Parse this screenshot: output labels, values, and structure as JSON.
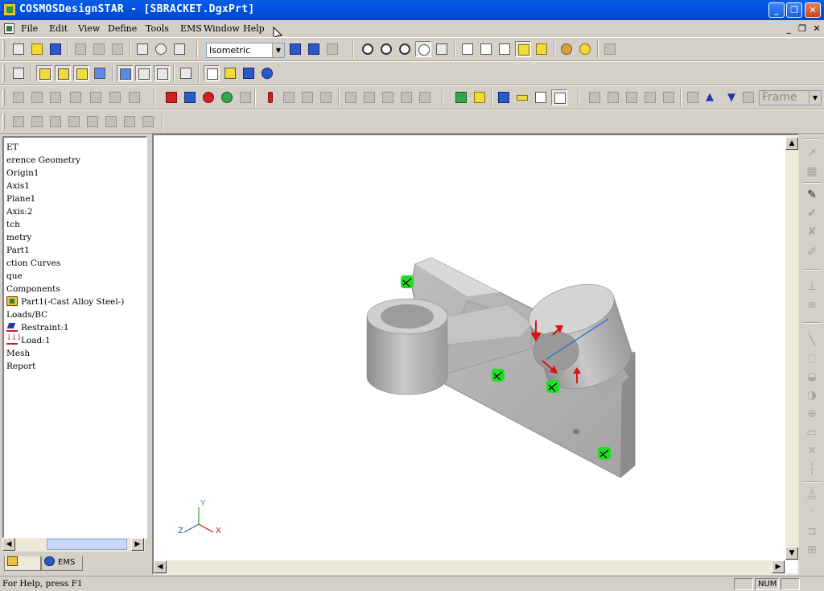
{
  "window": {
    "title": "COSMOSDesignSTAR - [SBRACKET.DgxPrt]",
    "minimize_glyph": "_",
    "restore_glyph": "❐",
    "close_glyph": "✕"
  },
  "menubar": {
    "items": [
      "File",
      "Edit",
      "View",
      "Define",
      "Tools",
      "EMS",
      "Window",
      "Help"
    ],
    "mdi_minimize": "_",
    "mdi_restore": "❐",
    "mdi_close": "✕"
  },
  "toolbar": {
    "view_select": "Isometric",
    "frame_select": "Frame"
  },
  "tree": {
    "items": [
      {
        "label": "ET",
        "icon": ""
      },
      {
        "label": "erence Geometry",
        "icon": ""
      },
      {
        "label": "Origin1",
        "icon": ""
      },
      {
        "label": "Axis1",
        "icon": ""
      },
      {
        "label": "Plane1",
        "icon": ""
      },
      {
        "label": "Axis:2",
        "icon": ""
      },
      {
        "label": "tch",
        "icon": ""
      },
      {
        "label": "metry",
        "icon": ""
      },
      {
        "label": "Part1",
        "icon": ""
      },
      {
        "label": "ction Curves",
        "icon": ""
      },
      {
        "label": "que",
        "icon": ""
      },
      {
        "label": "Components",
        "icon": ""
      },
      {
        "label": "Part1(-Cast Alloy Steel-)",
        "icon": "part-icon"
      },
      {
        "label": "Loads/BC",
        "icon": ""
      },
      {
        "label": "Restraint:1",
        "icon": "restraint-icon"
      },
      {
        "label": "Load:1",
        "icon": "load-icon"
      },
      {
        "label": "Mesh",
        "icon": ""
      },
      {
        "label": "Report",
        "icon": ""
      }
    ]
  },
  "panel_tabs": [
    {
      "label": "",
      "icon": "part-tab-icon"
    },
    {
      "label": "EMS",
      "icon": "ems-tab-icon"
    }
  ],
  "triad": {
    "x": "X",
    "y": "Y",
    "z": "Z"
  },
  "statusbar": {
    "message": "For Help, press F1",
    "num": "NUM"
  },
  "colors": {
    "titlebar": "#0054e3",
    "model_gray": "#b8b8b8",
    "restraint_green": "#22dd22",
    "load_red": "#dd1111",
    "axis_blue": "#2266cc"
  }
}
